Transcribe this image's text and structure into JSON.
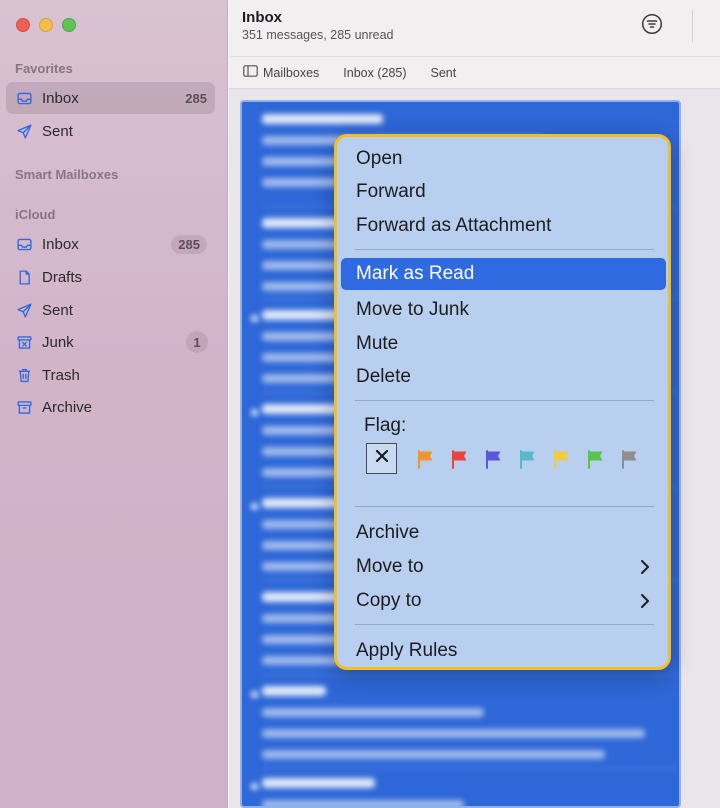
{
  "window": {
    "traffic_lights": {
      "close": "#ee5f57",
      "minimize": "#f5bd4f",
      "zoom": "#5fc454"
    }
  },
  "sidebar": {
    "favorites_title": "Favorites",
    "favorites": [
      {
        "label": "Inbox",
        "icon": "inbox-icon",
        "count": "285",
        "active": true
      },
      {
        "label": "Sent",
        "icon": "sent-icon",
        "count": ""
      }
    ],
    "smart_title": "Smart Mailboxes",
    "icloud_title": "iCloud",
    "icloud": [
      {
        "label": "Inbox",
        "icon": "inbox-icon",
        "count": "285"
      },
      {
        "label": "Drafts",
        "icon": "drafts-icon",
        "count": ""
      },
      {
        "label": "Sent",
        "icon": "sent-icon",
        "count": ""
      },
      {
        "label": "Junk",
        "icon": "junk-icon",
        "count": "1"
      },
      {
        "label": "Trash",
        "icon": "trash-icon",
        "count": ""
      },
      {
        "label": "Archive",
        "icon": "archive-icon",
        "count": ""
      }
    ]
  },
  "header": {
    "title": "Inbox",
    "subtitle": "351 messages, 285 unread",
    "filter_icon": "filter-icon"
  },
  "favorites_bar": {
    "mailboxes_label": "Mailboxes",
    "inbox_label": "Inbox (285)",
    "sent_label": "Sent"
  },
  "list": {
    "selection_color": "#2e67d7"
  },
  "menu": {
    "border_color": "#f4bf1e",
    "highlight_color": "#2f6ae0",
    "group1": [
      "Open",
      "Forward",
      "Forward as Attachment"
    ],
    "group2": [
      "Mark as Read",
      "Move to Junk",
      "Mute",
      "Delete"
    ],
    "highlighted": "Mark as Read",
    "flag_label": "Flag:",
    "flag_colors": [
      "#f0962e",
      "#e8453c",
      "#5c57d8",
      "#59b8c9",
      "#f2cc3c",
      "#5bc44b",
      "#8e8e8e"
    ],
    "group3": [
      "Archive",
      "Move to",
      "Copy to"
    ],
    "group4": [
      "Apply Rules"
    ]
  }
}
